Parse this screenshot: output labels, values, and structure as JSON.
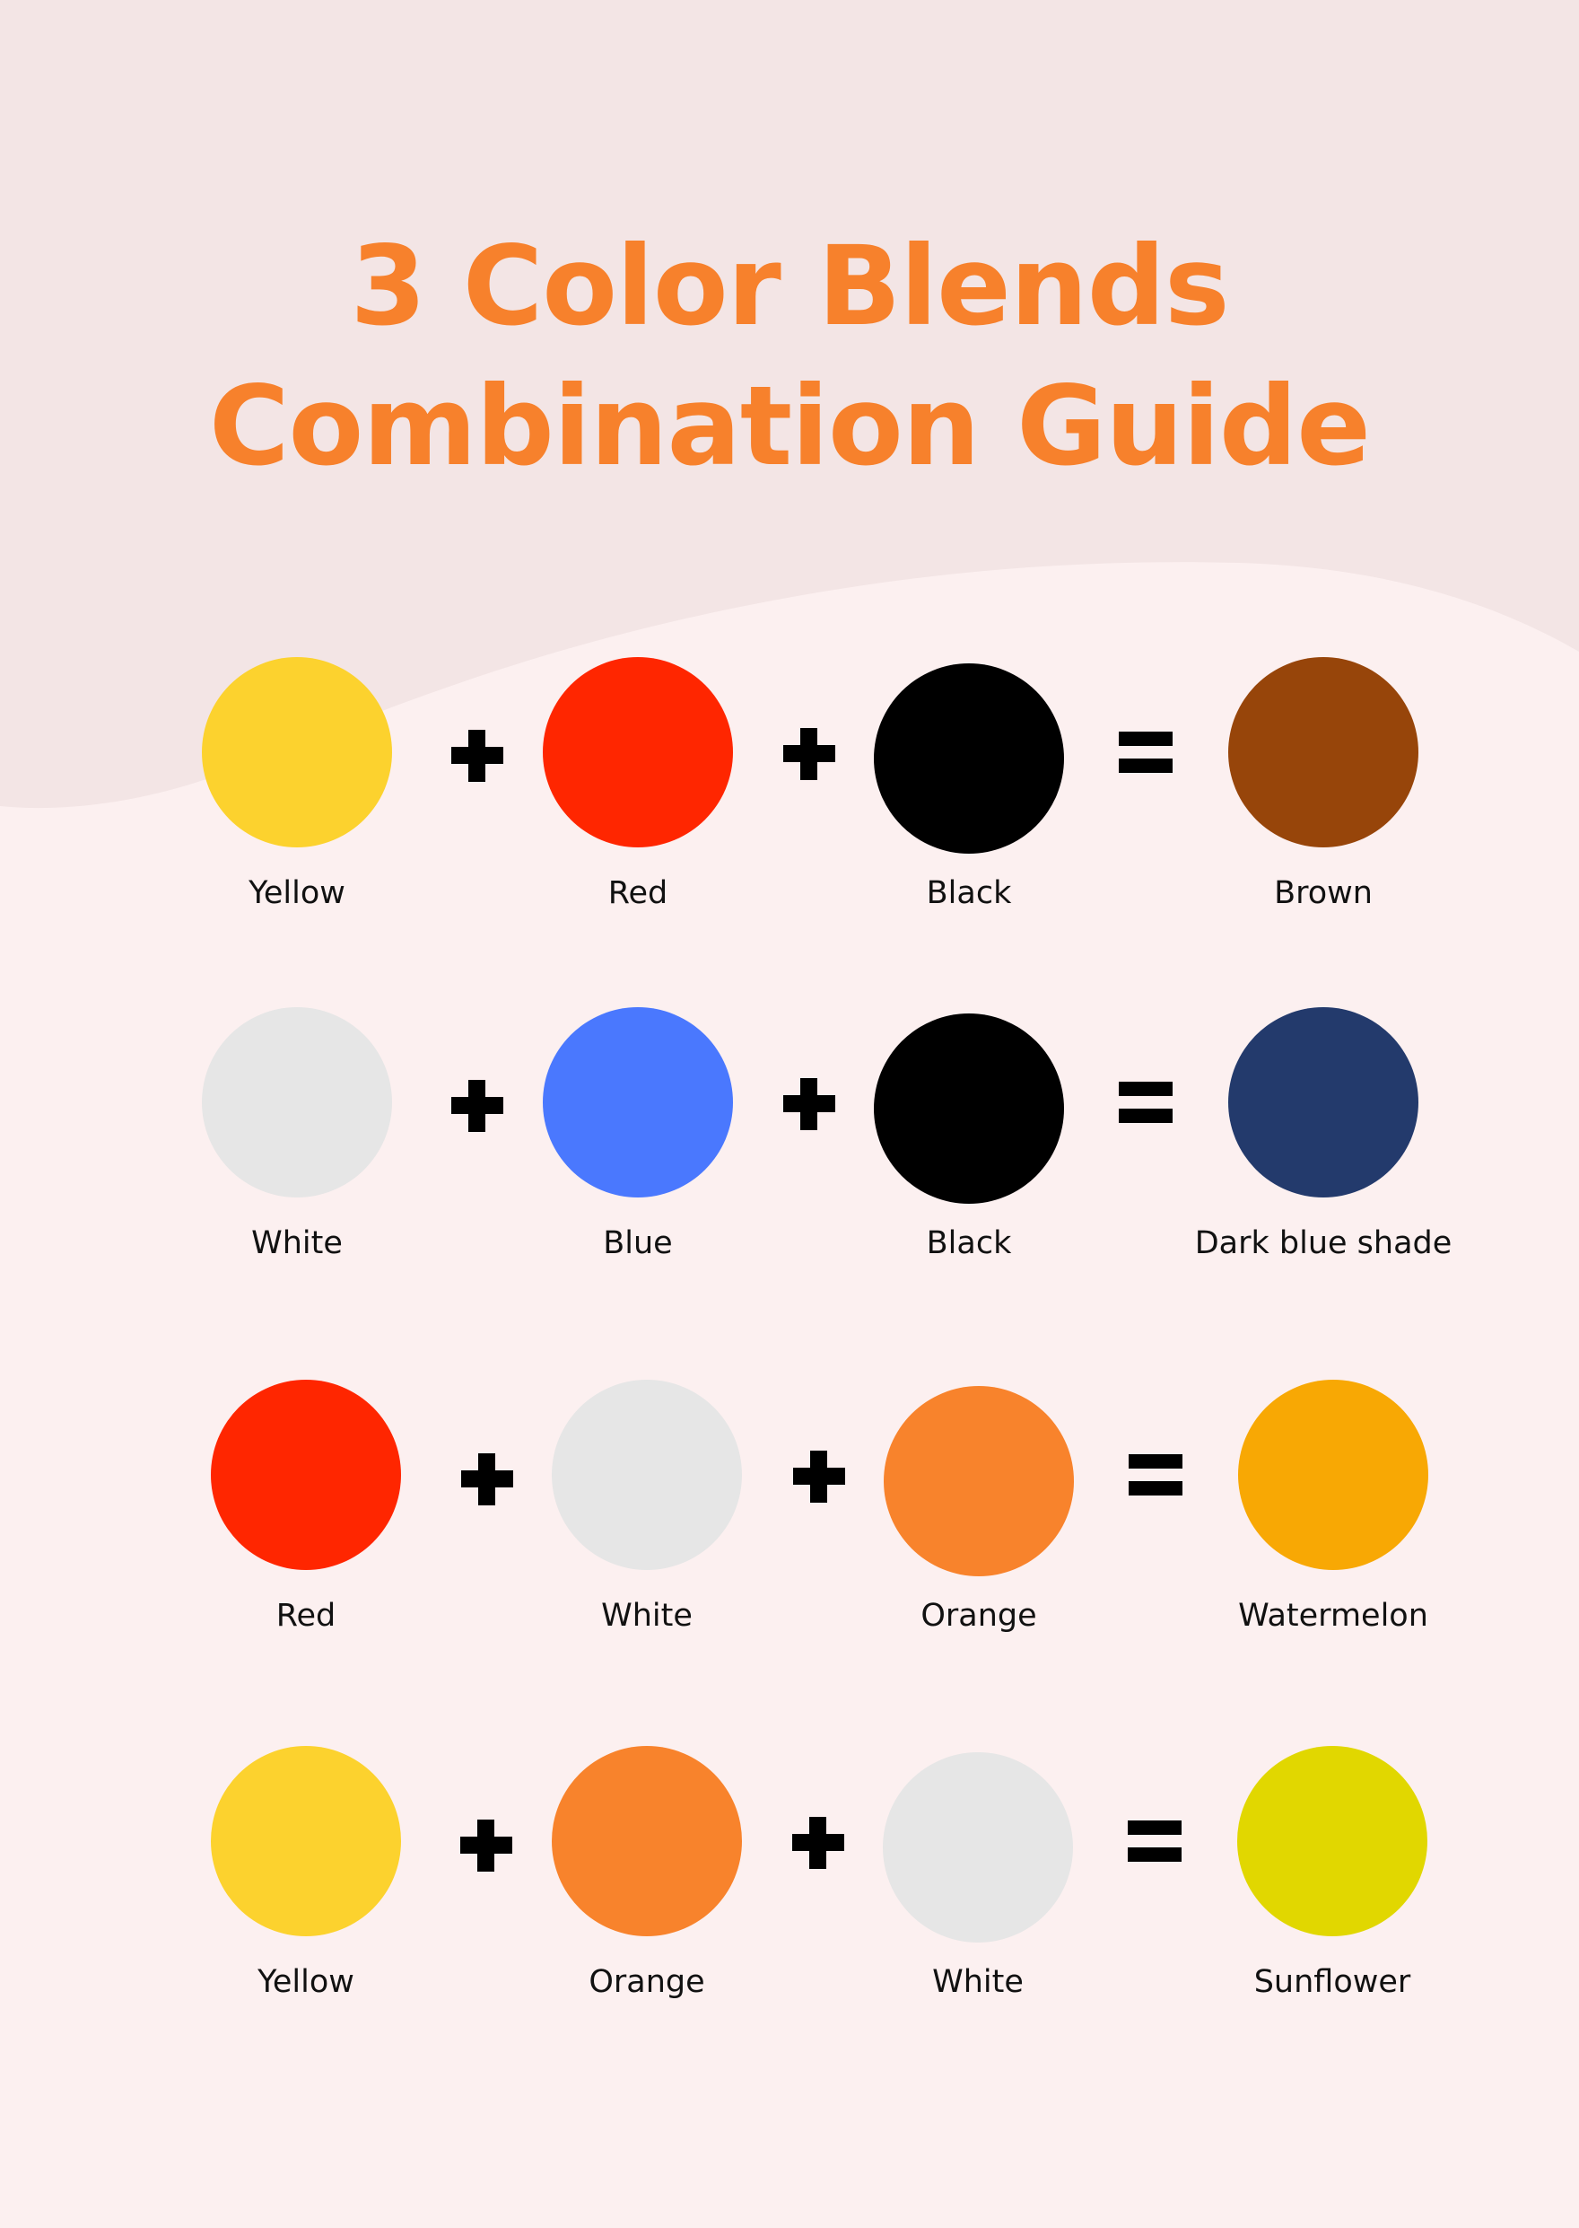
{
  "title": {
    "line1": "3 Color Blends",
    "line2": "Combination Guide",
    "color": "#f7812c"
  },
  "background": {
    "top": "#f3e5e5",
    "bottom": "#fcf0f0"
  },
  "rows": [
    {
      "inputs": [
        {
          "name": "Yellow",
          "color": "#fcd22e"
        },
        {
          "name": "Red",
          "color": "#ff2600"
        },
        {
          "name": "Black",
          "color": "#000000"
        }
      ],
      "result": {
        "name": "Brown",
        "color": "#97450a"
      }
    },
    {
      "inputs": [
        {
          "name": "White",
          "color": "#e6e6e6"
        },
        {
          "name": "Blue",
          "color": "#4a78fe"
        },
        {
          "name": "Black",
          "color": "#000000"
        }
      ],
      "result": {
        "name": "Dark blue shade",
        "color": "#233a6c"
      }
    },
    {
      "inputs": [
        {
          "name": "Red",
          "color": "#ff2600"
        },
        {
          "name": "White",
          "color": "#e6e6e6"
        },
        {
          "name": "Orange",
          "color": "#f8832c"
        }
      ],
      "result": {
        "name": "Watermelon",
        "color": "#f8a804"
      }
    },
    {
      "inputs": [
        {
          "name": "Yellow",
          "color": "#fcd22e"
        },
        {
          "name": "Orange",
          "color": "#f8832c"
        },
        {
          "name": "White",
          "color": "#e6e6e6"
        }
      ],
      "result": {
        "name": "Sunflower",
        "color": "#e1d700"
      }
    }
  ],
  "operators": {
    "plus": "plus-icon",
    "equals": "equals-icon"
  }
}
